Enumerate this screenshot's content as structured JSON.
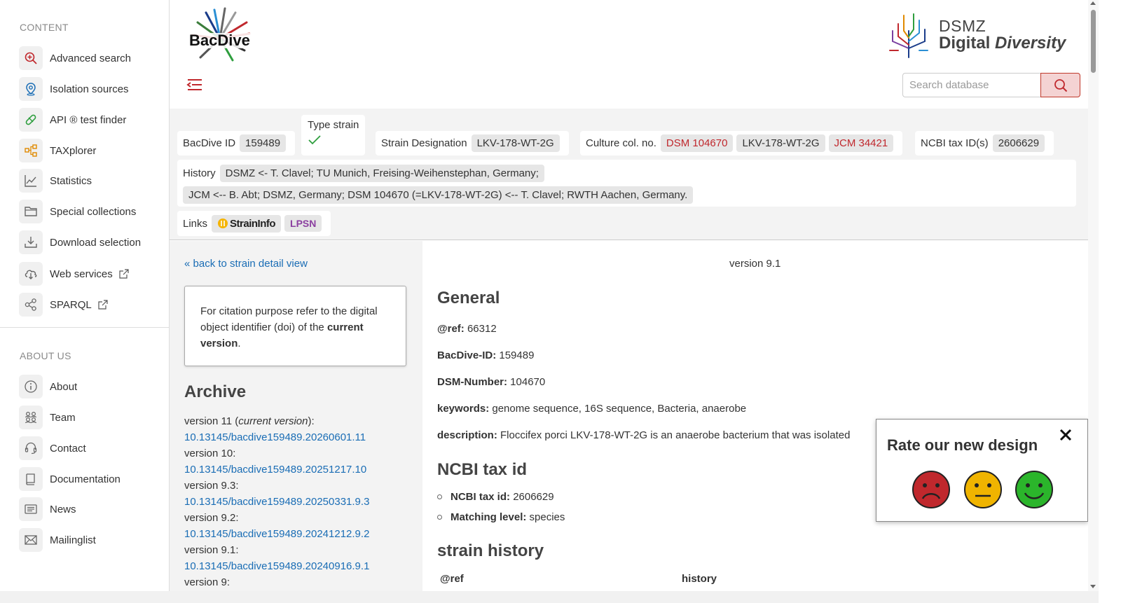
{
  "sidebar": {
    "content_heading": "CONTENT",
    "content_items": [
      {
        "label": "Advanced search",
        "icon": "search-plus-icon"
      },
      {
        "label": "Isolation sources",
        "icon": "map-pin-icon"
      },
      {
        "label": "API ® test finder",
        "icon": "pill-icon"
      },
      {
        "label": "TAXplorer",
        "icon": "hierarchy-icon"
      },
      {
        "label": "Statistics",
        "icon": "chart-line-icon"
      },
      {
        "label": "Special collections",
        "icon": "folder-icon"
      },
      {
        "label": "Download selection",
        "icon": "download-icon"
      },
      {
        "label": "Web services",
        "icon": "cloud-download-icon"
      },
      {
        "label": "SPARQL",
        "icon": "share-nodes-icon"
      }
    ],
    "about_heading": "ABOUT US",
    "about_items": [
      {
        "label": "About",
        "icon": "info-icon"
      },
      {
        "label": "Team",
        "icon": "team-icon"
      },
      {
        "label": "Contact",
        "icon": "headset-icon"
      },
      {
        "label": "Documentation",
        "icon": "book-icon"
      },
      {
        "label": "News",
        "icon": "newspaper-icon"
      },
      {
        "label": "Mailinglist",
        "icon": "envelope-icon"
      }
    ]
  },
  "header": {
    "logo_text": "BacDive",
    "dsmz_line1": "DSMZ",
    "dsmz_line2a": "Digital ",
    "dsmz_line2b": "Diversity",
    "search_placeholder": "Search database",
    "accent_color": "#c0282d"
  },
  "strain": {
    "bacdive_id_label": "BacDive ID",
    "bacdive_id": "159489",
    "type_strain_label": "Type strain",
    "strain_designation_label": "Strain Designation",
    "strain_designation": "LKV-178-WT-2G",
    "culture_label": "Culture col. no.",
    "culture_numbers": [
      "DSM 104670",
      "LKV-178-WT-2G",
      "JCM 34421"
    ],
    "ncbi_label": "NCBI tax ID(s)",
    "ncbi_id": "2606629",
    "history_label": "History",
    "history_1": "DSMZ <- T. Clavel; TU Munich, Freising-Weihenstephan, Germany;",
    "history_2": "JCM <-- B. Abt; DSMZ, Germany; DSM 104670 (=LKV-178-WT-2G) <-- T. Clavel; RWTH Aachen, Germany.",
    "links_label": "Links",
    "link_straininfo": "StrainInfo",
    "link_lpsn": "LPSN"
  },
  "left": {
    "back_link": "« back to strain detail view",
    "citation_text": "For citation purpose refer to the digital object identifier (doi) of the ",
    "citation_bold": "current version",
    "citation_end": ".",
    "archive_title": "Archive",
    "archive": [
      {
        "version": "version 11 (",
        "current": "current version",
        "suffix": "):",
        "doi": "10.13145/bacdive159489.20260601.11"
      },
      {
        "version": "version 10:",
        "doi": "10.13145/bacdive159489.20251217.10"
      },
      {
        "version": "version 9.3:",
        "doi": "10.13145/bacdive159489.20250331.9.3"
      },
      {
        "version": "version 9.2:",
        "doi": "10.13145/bacdive159489.20241212.9.2"
      },
      {
        "version": "version 9.1:",
        "doi": "10.13145/bacdive159489.20240916.9.1"
      },
      {
        "version": "version 9:",
        "doi": ""
      }
    ]
  },
  "main": {
    "version": "version 9.1",
    "general_title": "General",
    "ref_label": "@ref:",
    "ref_value": "66312",
    "bacdive_id_label": "BacDive-ID:",
    "bacdive_id_value": "159489",
    "dsm_label": "DSM-Number:",
    "dsm_value": "104670",
    "keywords_label": "keywords:",
    "keywords_value": "genome sequence, 16S sequence, Bacteria, anaerobe",
    "description_label": "description:",
    "description_value": "Floccifex porci LKV-178-WT-2G is an anaerobe bacterium that was isolated",
    "ncbi_title": "NCBI tax id",
    "ncbi_taxid_label": "NCBI tax id:",
    "ncbi_taxid_value": "2606629",
    "matching_label": "Matching level:",
    "matching_value": "species",
    "history_title": "strain history",
    "col_ref": "@ref",
    "col_history": "history"
  },
  "rating": {
    "title": "Rate our new design",
    "faces": [
      "sad-face-icon",
      "neutral-face-icon",
      "happy-face-icon"
    ],
    "colors": [
      "#c0282d",
      "#f0b400",
      "#2bb52b"
    ]
  }
}
